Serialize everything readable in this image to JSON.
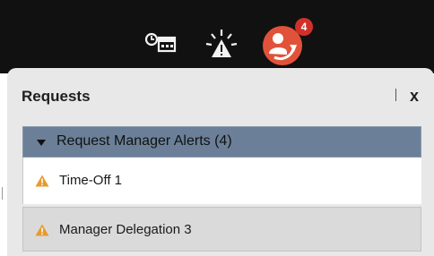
{
  "topbar": {
    "icons": [
      "schedule-icon",
      "alert-icon",
      "requests-icon"
    ],
    "requests_badge": "4",
    "colors": {
      "background": "#111111",
      "badge": "#d1302a",
      "requests_icon": "#e0533a"
    }
  },
  "panel": {
    "title": "Requests",
    "close_label": "x",
    "group": {
      "label": "Request Manager Alerts (4)",
      "color": "#6b8098"
    },
    "items": [
      {
        "label": "Time-Off 1",
        "icon": "warning-icon",
        "selected": true
      },
      {
        "label": "Manager Delegation 3",
        "icon": "warning-icon",
        "selected": false
      }
    ],
    "warning_color": "#e89a2c"
  }
}
